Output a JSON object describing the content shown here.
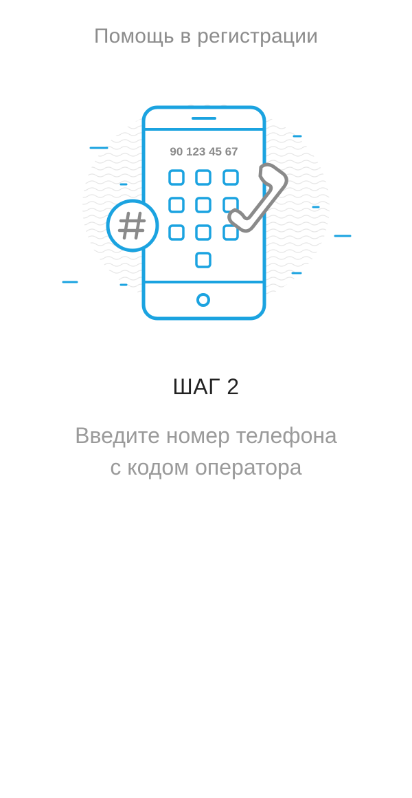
{
  "header": {
    "title": "Помощь в регистрации"
  },
  "illustration": {
    "phone_number_text": "90 123 45 67",
    "hash_symbol": "#",
    "icons": [
      "phone-icon",
      "keypad-icon",
      "hash-icon",
      "handset-icon"
    ],
    "colors": {
      "accent": "#1ba3e0",
      "handset": "#8a8a8a",
      "pattern": "#e9e9e9"
    }
  },
  "step": {
    "title": "ШАГ 2",
    "description_line1": "Введите номер телефона",
    "description_line2": "с кодом оператора"
  }
}
